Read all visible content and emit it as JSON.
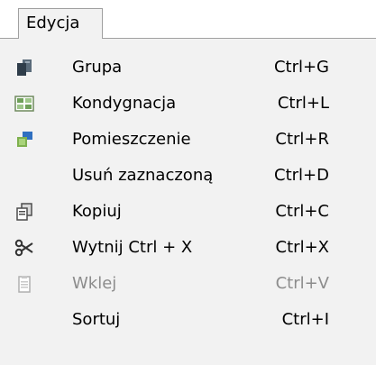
{
  "menubar": {
    "active_menu": "Edycja"
  },
  "menu": {
    "items": [
      {
        "label": "Grupa",
        "shortcut": "Ctrl+G",
        "icon": "group-icon",
        "enabled": true
      },
      {
        "label": "Kondygnacja",
        "shortcut": "Ctrl+L",
        "icon": "floor-icon",
        "enabled": true
      },
      {
        "label": "Pomieszczenie",
        "shortcut": "Ctrl+R",
        "icon": "room-icon",
        "enabled": true
      },
      {
        "label": "Usuń zaznaczoną",
        "shortcut": "Ctrl+D",
        "icon": "",
        "enabled": true
      },
      {
        "label": "Kopiuj",
        "shortcut": "Ctrl+C",
        "icon": "copy-icon",
        "enabled": true
      },
      {
        "label": "Wytnij Ctrl + X",
        "shortcut": "Ctrl+X",
        "icon": "scissors-icon",
        "enabled": true
      },
      {
        "label": "Wklej",
        "shortcut": "Ctrl+V",
        "icon": "paste-icon",
        "enabled": false
      },
      {
        "label": "Sortuj",
        "shortcut": "Ctrl+I",
        "icon": "",
        "enabled": true
      }
    ]
  }
}
